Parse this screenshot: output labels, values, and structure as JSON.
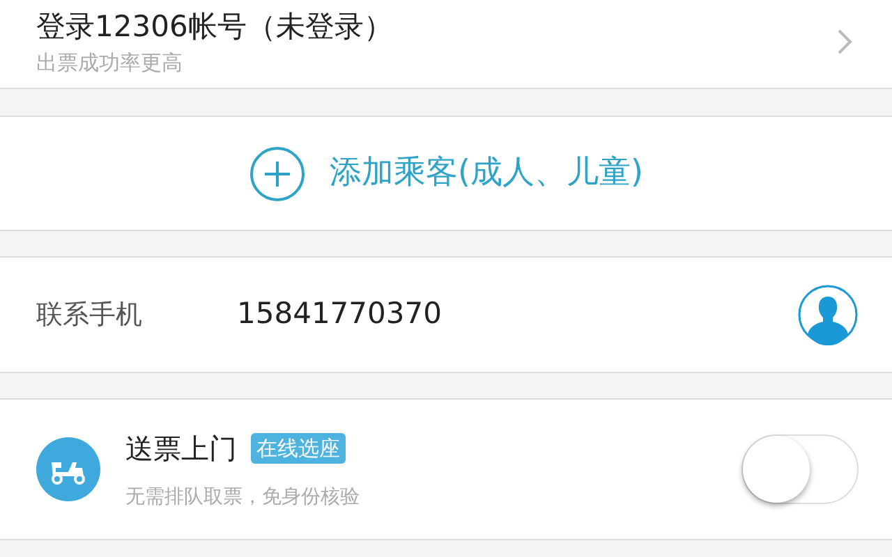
{
  "login": {
    "title": "登录12306帐号（未登录）",
    "subtitle": "出票成功率更高"
  },
  "add_passenger": {
    "label": "添加乘客(成人、儿童)"
  },
  "contact": {
    "label": "联系手机",
    "value": "15841770370"
  },
  "delivery": {
    "title": "送票上门",
    "badge": "在线选座",
    "subtitle": "无需排队取票，免身份核验",
    "on": false
  }
}
